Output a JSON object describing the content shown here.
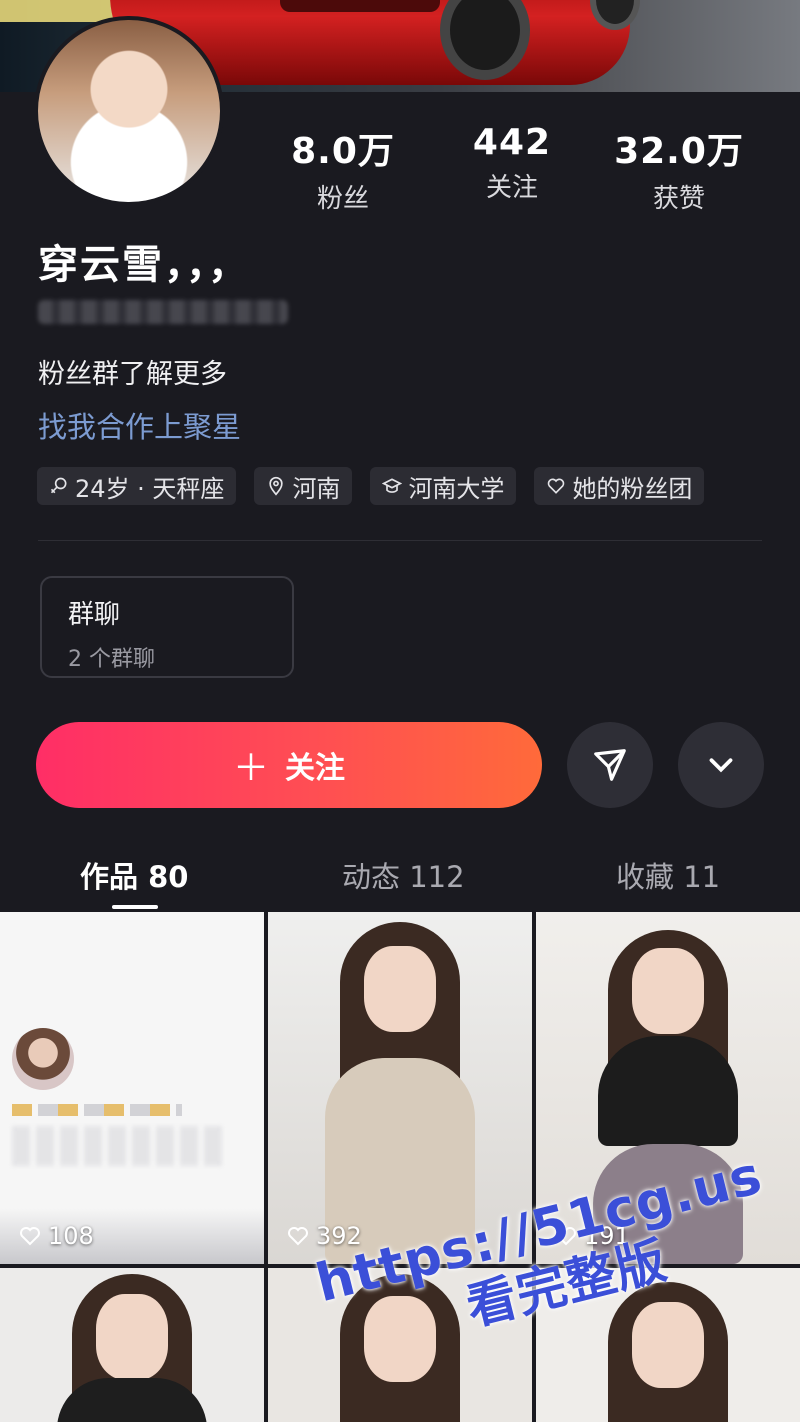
{
  "profile": {
    "name": "穿云雪，，，",
    "bio": "粉丝群了解更多",
    "cooperation_link": "找我合作上聚星"
  },
  "stats": [
    {
      "value": "8.0万",
      "label": "粉丝"
    },
    {
      "value": "442",
      "label": "关注"
    },
    {
      "value": "32.0万",
      "label": "获赞"
    }
  ],
  "tags": [
    {
      "icon": "gender-female-icon",
      "text": "24岁 · 天秤座"
    },
    {
      "icon": "location-pin-icon",
      "text": "河南"
    },
    {
      "icon": "school-icon",
      "text": "河南大学"
    },
    {
      "icon": "heart-icon",
      "text": "她的粉丝团"
    }
  ],
  "group_chat": {
    "title": "群聊",
    "subtitle": "2 个群聊"
  },
  "actions": {
    "follow_label": "关注",
    "send_icon": "paper-plane-icon",
    "more_icon": "chevron-down-icon"
  },
  "tabs": [
    {
      "label": "作品 80",
      "active": true
    },
    {
      "label": "动态 112",
      "active": false
    },
    {
      "label": "收藏 11",
      "active": false
    }
  ],
  "posts": [
    {
      "likes": "108"
    },
    {
      "likes": "392"
    },
    {
      "likes": "191"
    }
  ],
  "watermark": {
    "line1": "https://51cg.us",
    "line2": "看完整版"
  },
  "colors": {
    "background": "#1a1a20",
    "follow_gradient_start": "#ff2e66",
    "follow_gradient_end": "#ff6a3a",
    "link": "#7c9bd1",
    "watermark": "#3b4fd8"
  }
}
